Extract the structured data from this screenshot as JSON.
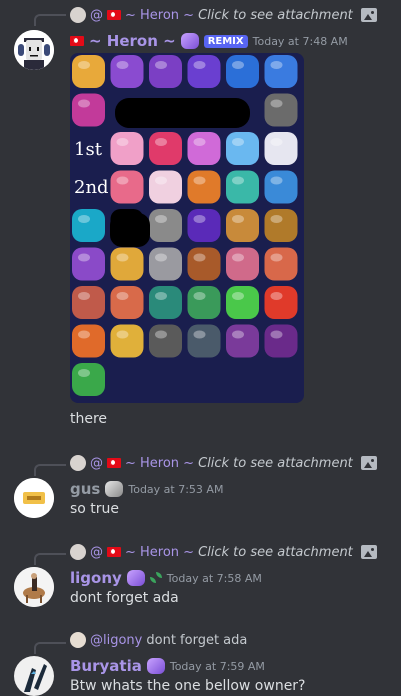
{
  "messages": [
    {
      "reply": {
        "at": "@",
        "name": "~ Heron ~",
        "text": "Click to see attachment"
      },
      "author": "~ Heron ~",
      "tag": "REMIX",
      "timestamp": "Today at 7:48 AM",
      "text": "there",
      "attachment": {
        "labels": [
          "1st",
          "2nd"
        ]
      }
    },
    {
      "reply": {
        "at": "@",
        "name": "~ Heron ~",
        "text": "Click to see attachment"
      },
      "author": "gus",
      "timestamp": "Today at 7:53 AM",
      "text": "so true"
    },
    {
      "reply": {
        "at": "@",
        "name": "~ Heron ~",
        "text": "Click to see attachment"
      },
      "author": "ligony",
      "timestamp": "Today at 7:58 AM",
      "text": "dont forget ada"
    },
    {
      "reply": {
        "at": "@ligony",
        "text": "dont forget ada"
      },
      "author": "Buryatia",
      "timestamp": "Today at 7:59 AM",
      "text": "Btw whats the one bellow owner?"
    }
  ],
  "colors": {
    "background": "#313338",
    "mention": "#a995e7",
    "author_default": "#949ba4",
    "author_purple": "#a995e7",
    "remix_badge": "#5865f2"
  }
}
